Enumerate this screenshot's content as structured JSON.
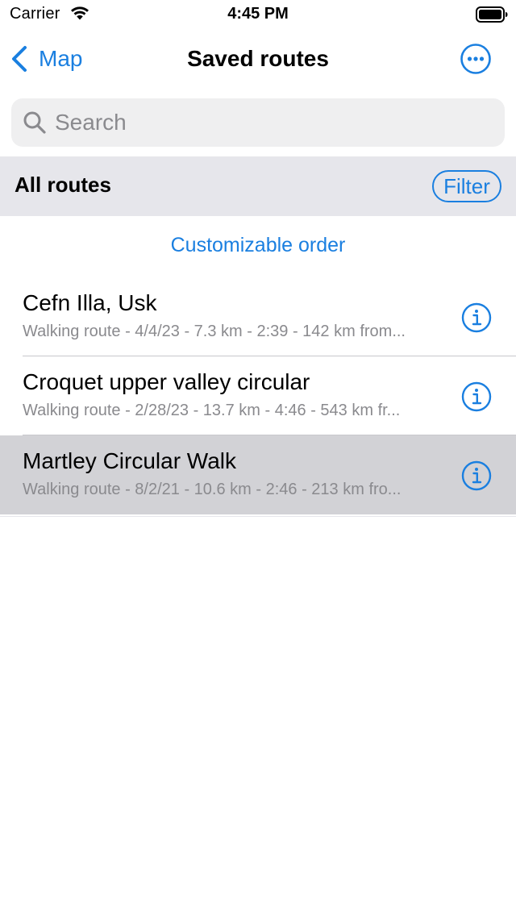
{
  "status_bar": {
    "carrier": "Carrier",
    "time": "4:45 PM"
  },
  "nav": {
    "back_label": "Map",
    "title": "Saved routes",
    "more_icon": "ellipsis-circle-icon"
  },
  "search": {
    "placeholder": "Search",
    "value": ""
  },
  "section": {
    "title": "All routes",
    "filter_label": "Filter"
  },
  "order_link": "Customizable order",
  "routes": [
    {
      "name": "Cefn Illa, Usk",
      "details": "Walking route - 4/4/23 - 7.3 km - 2:39 - 142 km from...",
      "selected": false
    },
    {
      "name": "Croquet upper valley circular",
      "details": "Walking route - 2/28/23 - 13.7 km - 4:46 - 543 km fr...",
      "selected": false
    },
    {
      "name": "Martley Circular Walk",
      "details": "Walking route - 8/2/21 - 10.6 km - 2:46 - 213 km fro...",
      "selected": true
    }
  ],
  "colors": {
    "accent": "#1a7fe0",
    "secondary_text": "#8a8a8e",
    "section_background": "#e6e6eb",
    "selected_row": "#d2d2d6"
  }
}
